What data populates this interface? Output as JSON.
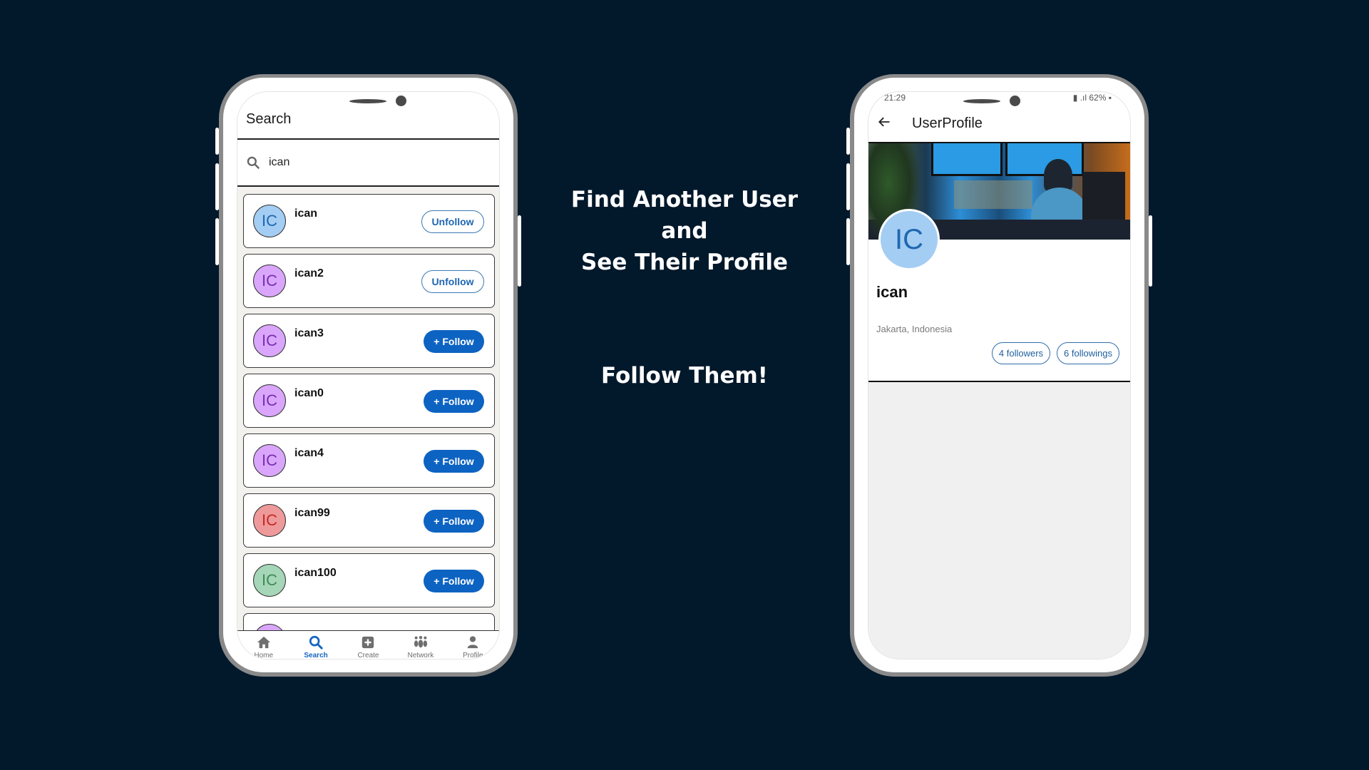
{
  "headline": {
    "line1": "Find Another User",
    "line2": "and",
    "line3": "See Their Profile",
    "cta": "Follow Them!"
  },
  "search_screen": {
    "title": "Search",
    "search": {
      "value": "ican",
      "icon": "search-icon"
    },
    "results": [
      {
        "username": "ican",
        "initials": "IC",
        "avatar_bg": "#a4cdf3",
        "avatar_fg": "#1f67b0",
        "action": "Unfollow",
        "following": true
      },
      {
        "username": "ican2",
        "initials": "IC",
        "avatar_bg": "#d9a6fb",
        "avatar_fg": "#7a2fb0",
        "action": "Unfollow",
        "following": true
      },
      {
        "username": "ican3",
        "initials": "IC",
        "avatar_bg": "#d9a6fb",
        "avatar_fg": "#7a2fb0",
        "action": "+ Follow",
        "following": false
      },
      {
        "username": "ican0",
        "initials": "IC",
        "avatar_bg": "#d9a6fb",
        "avatar_fg": "#7a2fb0",
        "action": "+ Follow",
        "following": false
      },
      {
        "username": "ican4",
        "initials": "IC",
        "avatar_bg": "#d9a6fb",
        "avatar_fg": "#7a2fb0",
        "action": "+ Follow",
        "following": false
      },
      {
        "username": "ican99",
        "initials": "IC",
        "avatar_bg": "#ef9a9a",
        "avatar_fg": "#c62828",
        "action": "+ Follow",
        "following": false
      },
      {
        "username": "ican100",
        "initials": "IC",
        "avatar_bg": "#a5d6b7",
        "avatar_fg": "#3f8a5a",
        "action": "+ Follow",
        "following": false
      },
      {
        "username": "",
        "initials": "",
        "avatar_bg": "#d9a6fb",
        "avatar_fg": "#7a2fb0",
        "action": "",
        "following": false
      }
    ],
    "bottom_nav": [
      {
        "label": "Home",
        "icon": "home-icon",
        "active": false
      },
      {
        "label": "Search",
        "icon": "search-icon",
        "active": true
      },
      {
        "label": "Create",
        "icon": "plus-square-icon",
        "active": false
      },
      {
        "label": "Network",
        "icon": "people-icon",
        "active": false
      },
      {
        "label": "Profile",
        "icon": "person-icon",
        "active": false
      }
    ]
  },
  "profile_screen": {
    "status_bar": {
      "time": "21:29",
      "battery": "62%"
    },
    "title": "UserProfile",
    "avatar_initials": "IC",
    "name": "ican",
    "location": "Jakarta, Indonesia",
    "followers_label": "4 followers",
    "followings_label": "6 followings"
  },
  "colors": {
    "background": "#02182b",
    "accent": "#0d63c2",
    "outline_accent": "#1f67b0"
  }
}
